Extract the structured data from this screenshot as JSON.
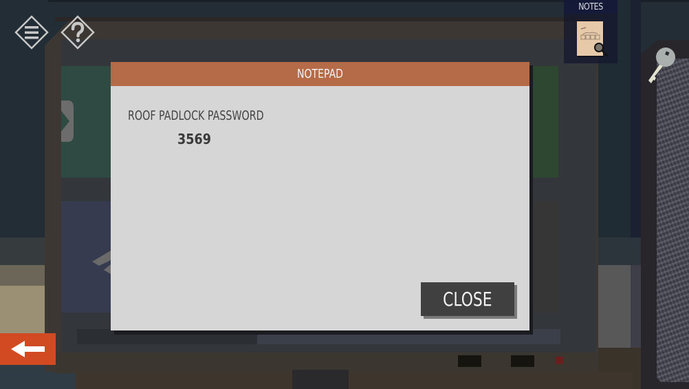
{
  "hud": {
    "menu_icon": "menu-icon",
    "help_icon": "help-icon",
    "notes_label": "NOTES",
    "notes_icon": "notes-magnifier-icon",
    "inventory_item": "key-icon",
    "back_icon": "arrow-left-icon"
  },
  "modal": {
    "title": "NOTEPAD",
    "note_label": "ROOF PADLOCK PASSWORD",
    "note_value": "3569",
    "close_label": "CLOSE"
  },
  "colors": {
    "header": "#b56b48",
    "back_button": "#d24a22",
    "modal_body": "#d6d6d6",
    "close_button": "#404040"
  }
}
